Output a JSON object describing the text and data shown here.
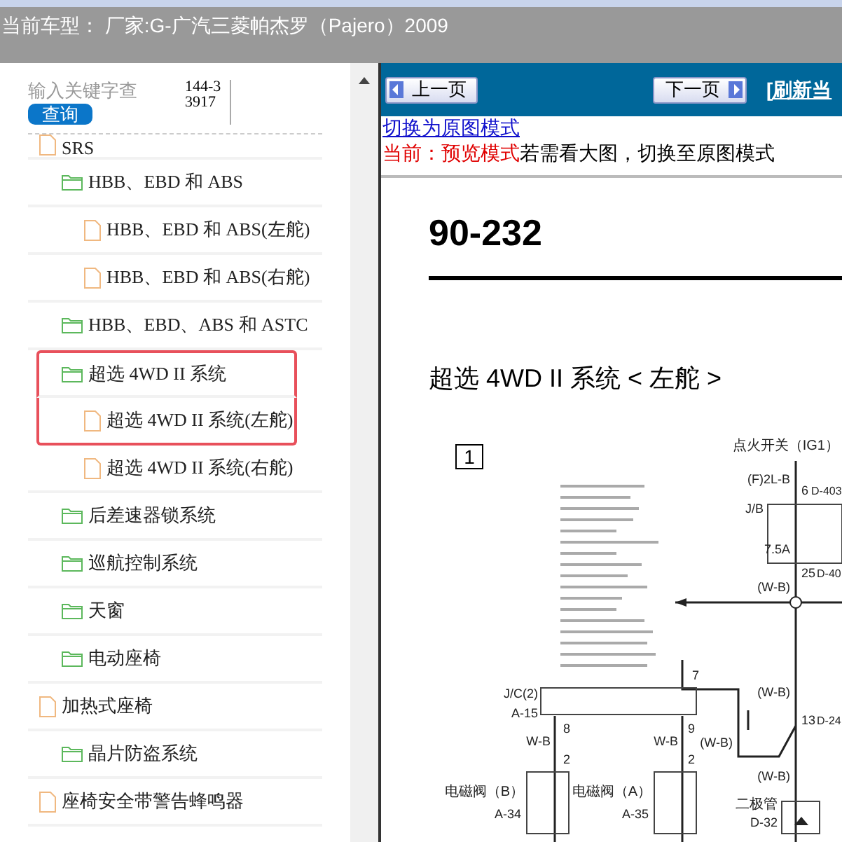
{
  "header": {
    "title": "当前车型： 厂家:G-广汽三菱帕杰罗（Pajero）2009"
  },
  "search": {
    "placeholder": "输入关键字查",
    "button": "查询",
    "code": "144-33917"
  },
  "tree": {
    "items": [
      {
        "label": "SRS",
        "kind": "file",
        "highlighted": false,
        "children": [
          {
            "label": "HBB、EBD 和 ABS",
            "kind": "folder",
            "highlighted": false,
            "children": [
              {
                "label": "HBB、EBD 和 ABS(左舵)",
                "kind": "file",
                "highlighted": false
              },
              {
                "label": "HBB、EBD 和 ABS(右舵)",
                "kind": "file",
                "highlighted": false
              }
            ]
          },
          {
            "label": "HBB、EBD、ABS 和 ASTC",
            "kind": "folder",
            "highlighted": false
          },
          {
            "label": "超选 4WD II 系统",
            "kind": "folder",
            "highlighted": true,
            "children": [
              {
                "label": "超选 4WD II 系统(左舵)",
                "kind": "file",
                "highlighted": true
              },
              {
                "label": "超选 4WD II 系统(右舵)",
                "kind": "file",
                "highlighted": false
              }
            ]
          },
          {
            "label": "后差速器锁系统",
            "kind": "folder",
            "highlighted": false
          },
          {
            "label": "巡航控制系统",
            "kind": "folder",
            "highlighted": false
          },
          {
            "label": "天窗",
            "kind": "folder",
            "highlighted": false
          },
          {
            "label": "电动座椅",
            "kind": "folder",
            "highlighted": false
          }
        ]
      },
      {
        "label": "加热式座椅",
        "kind": "file",
        "highlighted": false,
        "children": [
          {
            "label": "晶片防盗系统",
            "kind": "folder",
            "highlighted": false
          }
        ]
      },
      {
        "label": "座椅安全带警告蜂鸣器",
        "kind": "file",
        "highlighted": false
      }
    ]
  },
  "toolbar": {
    "prev": "上一页",
    "next": "下一页",
    "refresh_link": "[刷新当"
  },
  "mode_link": "切换为原图模式",
  "mode_notice": {
    "current": "当前：预览模式",
    "hint": "若需看大图，切换至原图模式"
  },
  "document": {
    "page_number": "90-232",
    "title": "超选 4WD II 系统 < 左舵 >",
    "section": "1",
    "diagram_labels": [
      "点火开关（IG1）",
      "(F)2L-B",
      "6",
      "D-403",
      "J/B",
      "7.5A",
      "25",
      "D-40",
      "(W-B)",
      "7",
      "J/C(2)",
      "A-15",
      "8",
      "9",
      "W-B",
      "W-B",
      "(W-B)",
      "(W-B)",
      "13",
      "D-24",
      "2",
      "2",
      "(W-B)",
      "电磁阀（B）",
      "A-34",
      "电磁阀（A）",
      "A-35",
      "二极管",
      "D-32"
    ]
  }
}
